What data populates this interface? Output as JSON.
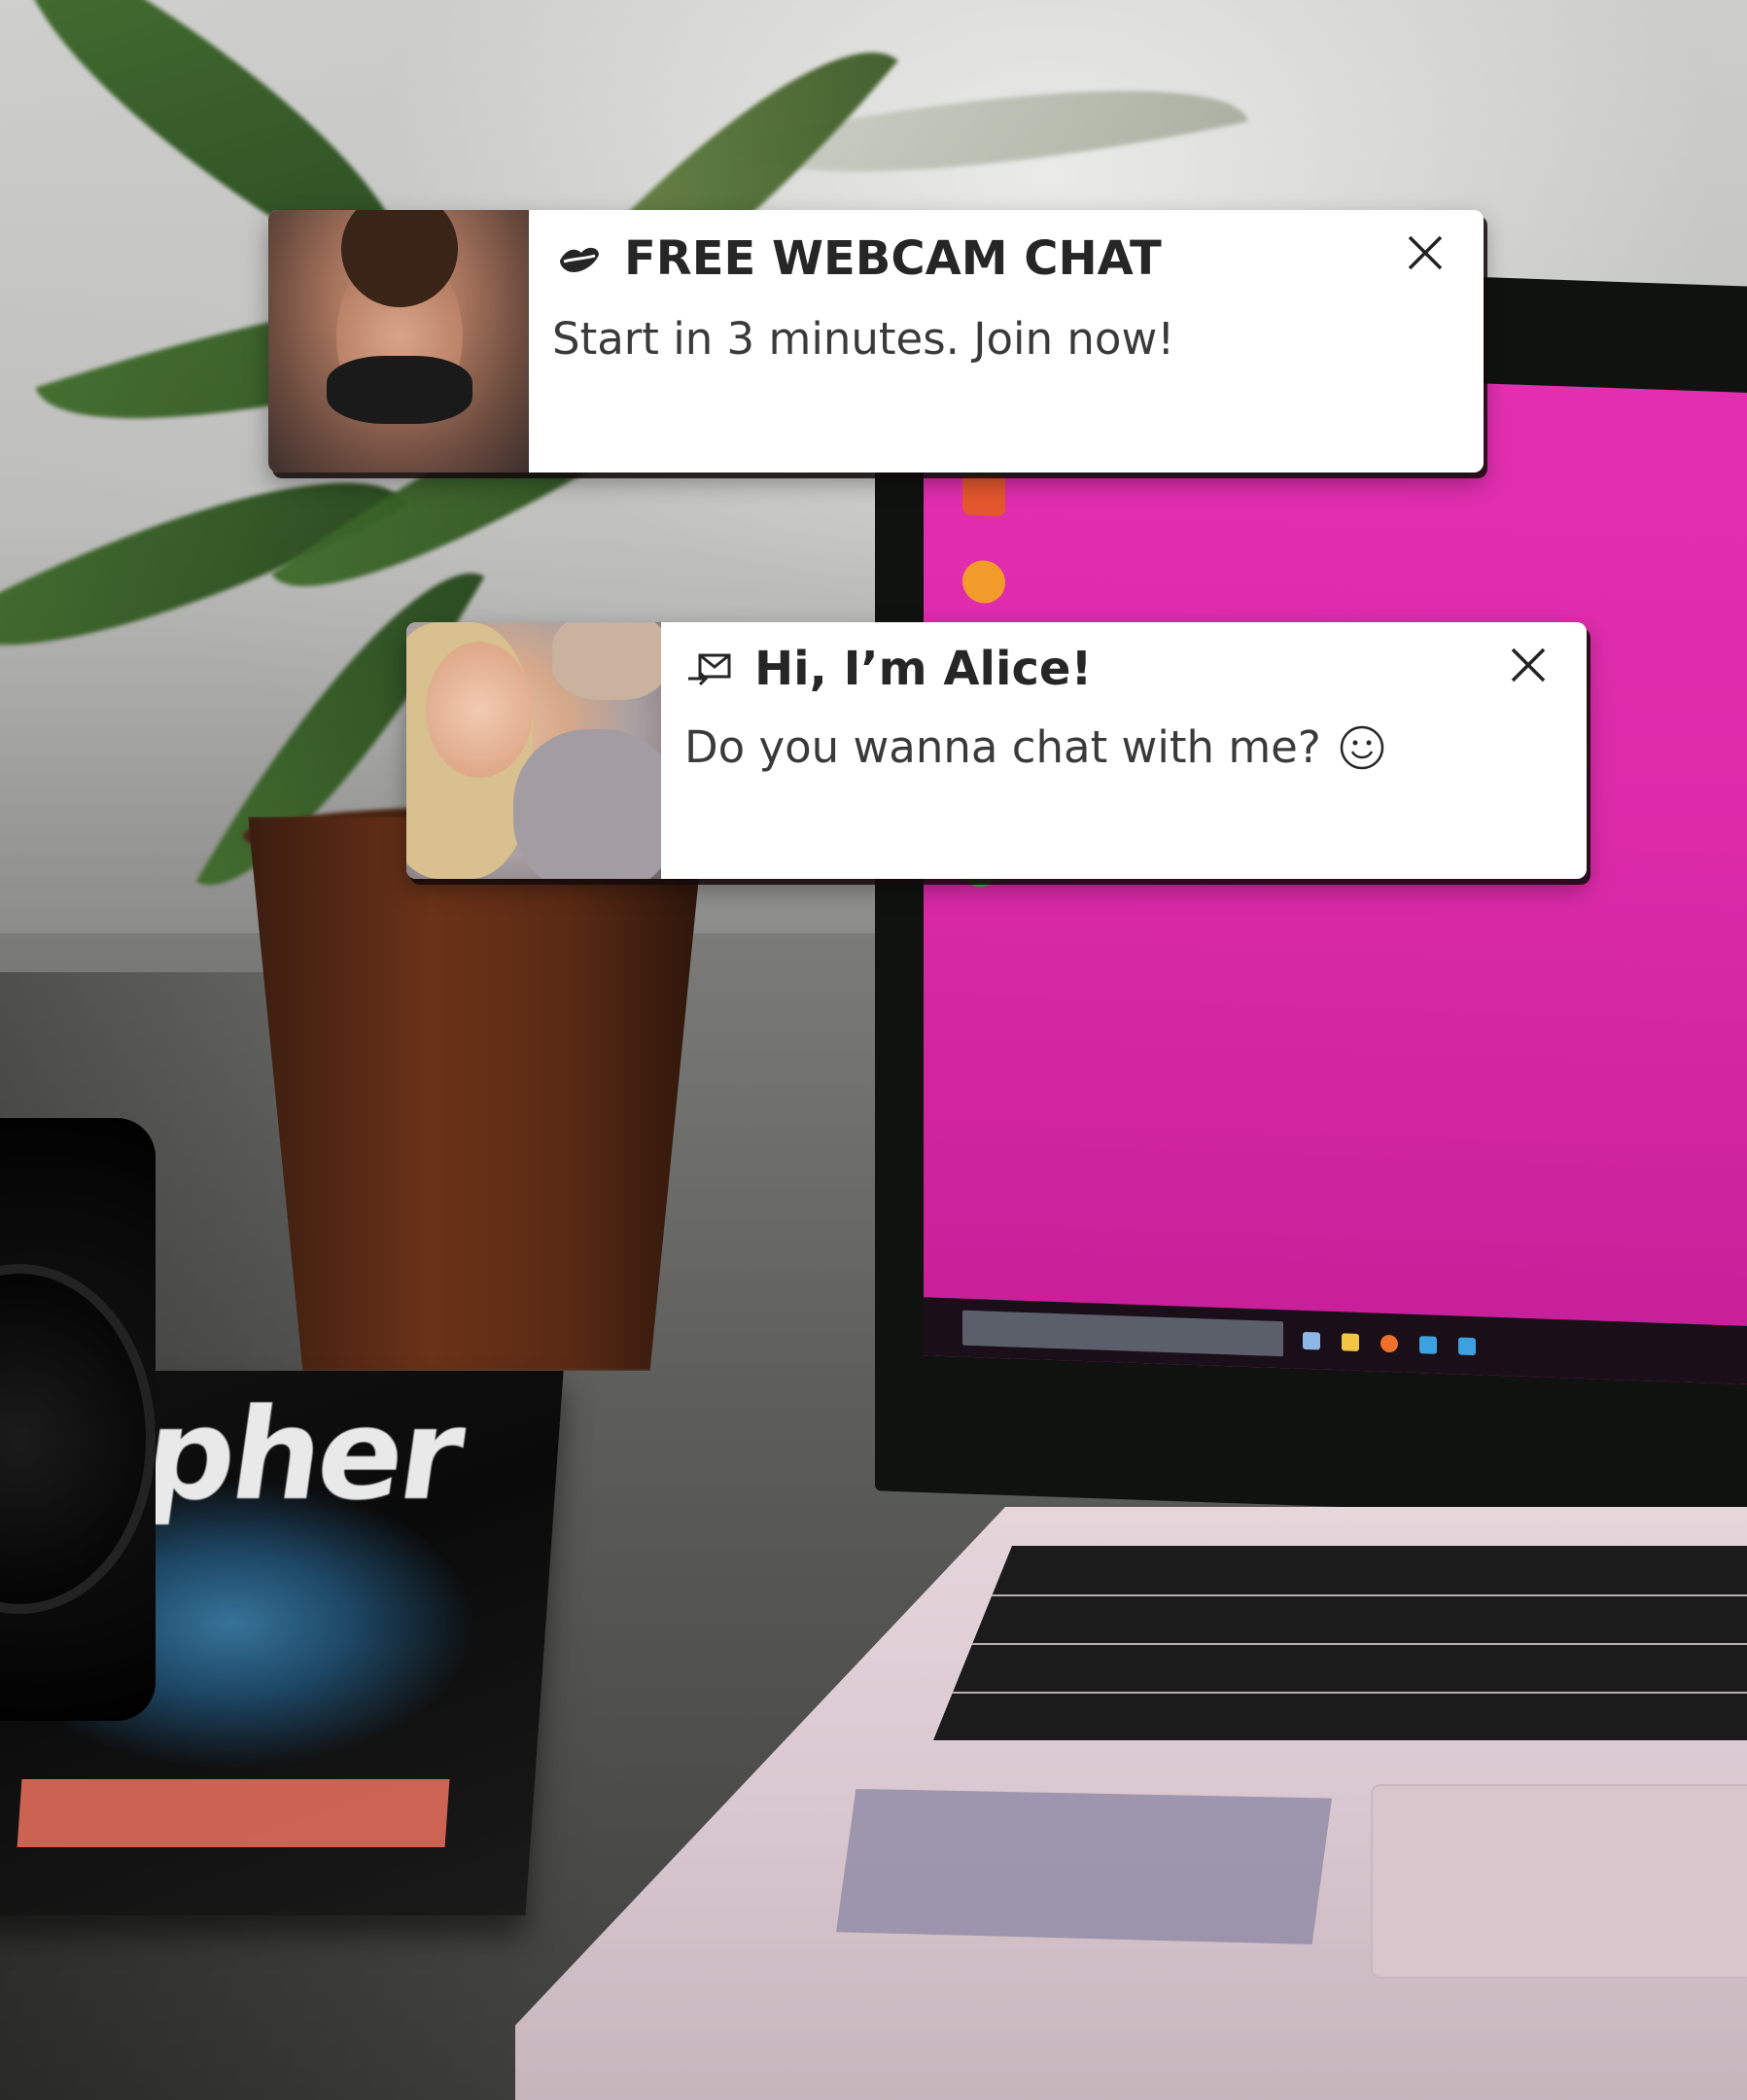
{
  "notifications": [
    {
      "icon": "lips-icon",
      "title": "FREE WEBCAM CHAT",
      "message": "Start in 3 minutes. Join now!",
      "close_icon": "close-icon"
    },
    {
      "icon": "message-arrow-icon",
      "title": "Hi, I’m Alice!",
      "message": "Do you wanna chat with me?",
      "trailing_icon": "smile-icon",
      "close_icon": "close-icon"
    }
  ],
  "magazine": {
    "title": "pher"
  },
  "colors": {
    "screen_background": "#dc2aa9",
    "popup_background": "#ffffff",
    "popup_text": "#262626",
    "popup_shadow": "#140a0a"
  }
}
